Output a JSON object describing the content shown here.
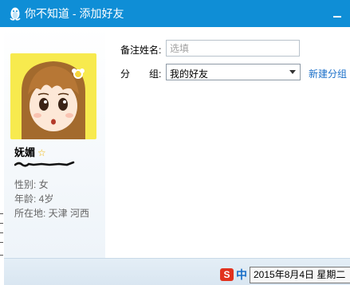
{
  "window": {
    "title": "你不知道 - 添加好友",
    "title_icon": "qq-penguin-icon",
    "minimize_icon": "minimize-icon",
    "accent_color": "#0f8ed6"
  },
  "profile": {
    "name": "妩媚",
    "badge_icon": "star-icon",
    "gender_label": "性别: 女",
    "age_label": "年龄: 4岁",
    "location_label": "所在地: 天津  河西"
  },
  "form": {
    "remark_label": "备注姓名:",
    "remark_placeholder": "选填",
    "group_label_a": "分",
    "group_label_b": "组:",
    "group_selected": "我的好友",
    "new_group_link": "新建分组"
  },
  "taskbar": {
    "ime_logo": "S",
    "ime_mode": "中",
    "date_tooltip": "2015年8月4日 星期二"
  }
}
